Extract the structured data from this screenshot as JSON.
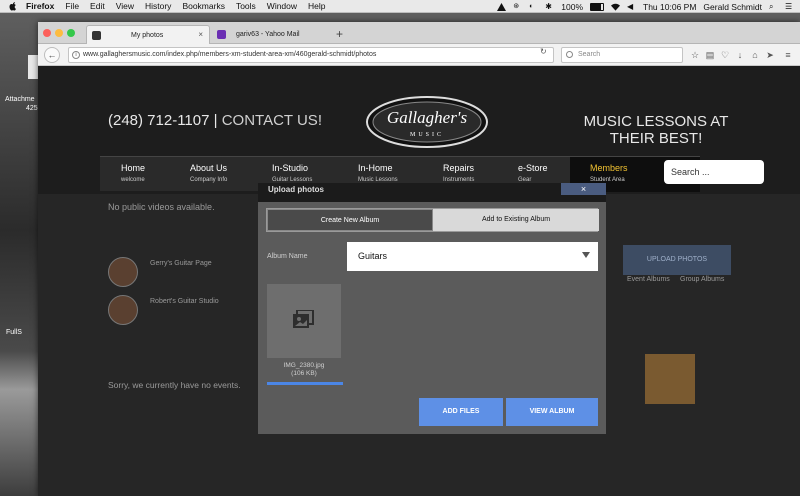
{
  "menubar": {
    "app": "Firefox",
    "items": [
      "File",
      "Edit",
      "View",
      "History",
      "Bookmarks",
      "Tools",
      "Window",
      "Help"
    ],
    "battery": "100%",
    "time": "Thu 10:06 PM",
    "user": "Gerald Schmidt"
  },
  "desktop": {
    "label1": "Attachme",
    "label2": "425",
    "label3": "FullS"
  },
  "browser": {
    "tabs": [
      {
        "title": "My photos",
        "active": true
      },
      {
        "title": "gariv63 - Yahoo Mail",
        "active": false
      }
    ],
    "new_tab": "+",
    "url": "www.gallaghersmusic.com/index.php/members-xm-student-area-xm/460gerald-schmidt/photos",
    "search_placeholder": "Search"
  },
  "site": {
    "phone": "(248) 712-1107 |",
    "contact": " CONTACT US!",
    "logo_text": "Gallagher's",
    "logo_sub": "MUSIC",
    "tagline": "MUSIC LESSONS AT THEIR BEST!",
    "nav": [
      {
        "label": "Home",
        "sub": "welcome"
      },
      {
        "label": "About Us",
        "sub": "Company Info"
      },
      {
        "label": "In-Studio",
        "sub": "Guitar Lessons"
      },
      {
        "label": "In-Home",
        "sub": "Music Lessons"
      },
      {
        "label": "Repairs",
        "sub": "Instruments"
      },
      {
        "label": "e-Store",
        "sub": "Gear"
      },
      {
        "label": "Members",
        "sub": "Student Area"
      }
    ],
    "search_placeholder": "Search ..."
  },
  "background": {
    "no_videos": "No public videos available.",
    "page_label1": "Gerry's Guitar Page",
    "page_label2": "Robert's Guitar Studio",
    "no_events": "Sorry, we currently have no events.",
    "upload_photos": "UPLOAD PHOTOS",
    "event_albums": "Event Albums",
    "group_albums": "Group Albums"
  },
  "modal": {
    "title": "Upload photos",
    "close": "×",
    "tab_new": "Create New Album",
    "tab_existing": "Add to Existing Album",
    "album_label": "Album Name",
    "album_value": "Guitars",
    "file_name": "IMG_2380.jpg",
    "file_size": "(106 KB)",
    "upload_progress": 1.0,
    "add_files": "ADD FILES",
    "view_album": "VIEW ALBUM"
  },
  "colors": {
    "accent_blue": "#5e90e6",
    "members_gold": "#f1c232",
    "page_bg": "#1d1d1d"
  }
}
